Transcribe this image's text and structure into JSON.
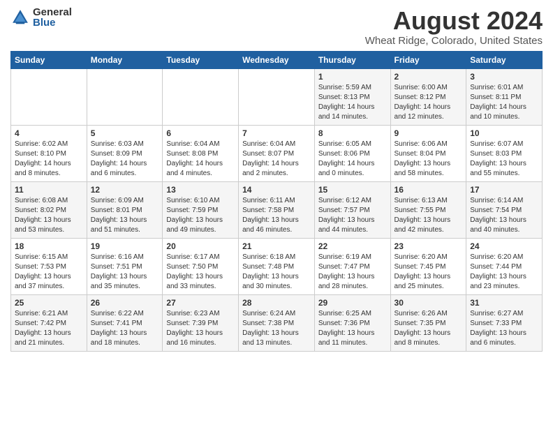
{
  "logo": {
    "general": "General",
    "blue": "Blue"
  },
  "title": "August 2024",
  "location": "Wheat Ridge, Colorado, United States",
  "weekdays": [
    "Sunday",
    "Monday",
    "Tuesday",
    "Wednesday",
    "Thursday",
    "Friday",
    "Saturday"
  ],
  "weeks": [
    [
      {
        "day": "",
        "sunrise": "",
        "sunset": "",
        "daylight": ""
      },
      {
        "day": "",
        "sunrise": "",
        "sunset": "",
        "daylight": ""
      },
      {
        "day": "",
        "sunrise": "",
        "sunset": "",
        "daylight": ""
      },
      {
        "day": "",
        "sunrise": "",
        "sunset": "",
        "daylight": ""
      },
      {
        "day": "1",
        "sunrise": "Sunrise: 5:59 AM",
        "sunset": "Sunset: 8:13 PM",
        "daylight": "Daylight: 14 hours and 14 minutes."
      },
      {
        "day": "2",
        "sunrise": "Sunrise: 6:00 AM",
        "sunset": "Sunset: 8:12 PM",
        "daylight": "Daylight: 14 hours and 12 minutes."
      },
      {
        "day": "3",
        "sunrise": "Sunrise: 6:01 AM",
        "sunset": "Sunset: 8:11 PM",
        "daylight": "Daylight: 14 hours and 10 minutes."
      }
    ],
    [
      {
        "day": "4",
        "sunrise": "Sunrise: 6:02 AM",
        "sunset": "Sunset: 8:10 PM",
        "daylight": "Daylight: 14 hours and 8 minutes."
      },
      {
        "day": "5",
        "sunrise": "Sunrise: 6:03 AM",
        "sunset": "Sunset: 8:09 PM",
        "daylight": "Daylight: 14 hours and 6 minutes."
      },
      {
        "day": "6",
        "sunrise": "Sunrise: 6:04 AM",
        "sunset": "Sunset: 8:08 PM",
        "daylight": "Daylight: 14 hours and 4 minutes."
      },
      {
        "day": "7",
        "sunrise": "Sunrise: 6:04 AM",
        "sunset": "Sunset: 8:07 PM",
        "daylight": "Daylight: 14 hours and 2 minutes."
      },
      {
        "day": "8",
        "sunrise": "Sunrise: 6:05 AM",
        "sunset": "Sunset: 8:06 PM",
        "daylight": "Daylight: 14 hours and 0 minutes."
      },
      {
        "day": "9",
        "sunrise": "Sunrise: 6:06 AM",
        "sunset": "Sunset: 8:04 PM",
        "daylight": "Daylight: 13 hours and 58 minutes."
      },
      {
        "day": "10",
        "sunrise": "Sunrise: 6:07 AM",
        "sunset": "Sunset: 8:03 PM",
        "daylight": "Daylight: 13 hours and 55 minutes."
      }
    ],
    [
      {
        "day": "11",
        "sunrise": "Sunrise: 6:08 AM",
        "sunset": "Sunset: 8:02 PM",
        "daylight": "Daylight: 13 hours and 53 minutes."
      },
      {
        "day": "12",
        "sunrise": "Sunrise: 6:09 AM",
        "sunset": "Sunset: 8:01 PM",
        "daylight": "Daylight: 13 hours and 51 minutes."
      },
      {
        "day": "13",
        "sunrise": "Sunrise: 6:10 AM",
        "sunset": "Sunset: 7:59 PM",
        "daylight": "Daylight: 13 hours and 49 minutes."
      },
      {
        "day": "14",
        "sunrise": "Sunrise: 6:11 AM",
        "sunset": "Sunset: 7:58 PM",
        "daylight": "Daylight: 13 hours and 46 minutes."
      },
      {
        "day": "15",
        "sunrise": "Sunrise: 6:12 AM",
        "sunset": "Sunset: 7:57 PM",
        "daylight": "Daylight: 13 hours and 44 minutes."
      },
      {
        "day": "16",
        "sunrise": "Sunrise: 6:13 AM",
        "sunset": "Sunset: 7:55 PM",
        "daylight": "Daylight: 13 hours and 42 minutes."
      },
      {
        "day": "17",
        "sunrise": "Sunrise: 6:14 AM",
        "sunset": "Sunset: 7:54 PM",
        "daylight": "Daylight: 13 hours and 40 minutes."
      }
    ],
    [
      {
        "day": "18",
        "sunrise": "Sunrise: 6:15 AM",
        "sunset": "Sunset: 7:53 PM",
        "daylight": "Daylight: 13 hours and 37 minutes."
      },
      {
        "day": "19",
        "sunrise": "Sunrise: 6:16 AM",
        "sunset": "Sunset: 7:51 PM",
        "daylight": "Daylight: 13 hours and 35 minutes."
      },
      {
        "day": "20",
        "sunrise": "Sunrise: 6:17 AM",
        "sunset": "Sunset: 7:50 PM",
        "daylight": "Daylight: 13 hours and 33 minutes."
      },
      {
        "day": "21",
        "sunrise": "Sunrise: 6:18 AM",
        "sunset": "Sunset: 7:48 PM",
        "daylight": "Daylight: 13 hours and 30 minutes."
      },
      {
        "day": "22",
        "sunrise": "Sunrise: 6:19 AM",
        "sunset": "Sunset: 7:47 PM",
        "daylight": "Daylight: 13 hours and 28 minutes."
      },
      {
        "day": "23",
        "sunrise": "Sunrise: 6:20 AM",
        "sunset": "Sunset: 7:45 PM",
        "daylight": "Daylight: 13 hours and 25 minutes."
      },
      {
        "day": "24",
        "sunrise": "Sunrise: 6:20 AM",
        "sunset": "Sunset: 7:44 PM",
        "daylight": "Daylight: 13 hours and 23 minutes."
      }
    ],
    [
      {
        "day": "25",
        "sunrise": "Sunrise: 6:21 AM",
        "sunset": "Sunset: 7:42 PM",
        "daylight": "Daylight: 13 hours and 21 minutes."
      },
      {
        "day": "26",
        "sunrise": "Sunrise: 6:22 AM",
        "sunset": "Sunset: 7:41 PM",
        "daylight": "Daylight: 13 hours and 18 minutes."
      },
      {
        "day": "27",
        "sunrise": "Sunrise: 6:23 AM",
        "sunset": "Sunset: 7:39 PM",
        "daylight": "Daylight: 13 hours and 16 minutes."
      },
      {
        "day": "28",
        "sunrise": "Sunrise: 6:24 AM",
        "sunset": "Sunset: 7:38 PM",
        "daylight": "Daylight: 13 hours and 13 minutes."
      },
      {
        "day": "29",
        "sunrise": "Sunrise: 6:25 AM",
        "sunset": "Sunset: 7:36 PM",
        "daylight": "Daylight: 13 hours and 11 minutes."
      },
      {
        "day": "30",
        "sunrise": "Sunrise: 6:26 AM",
        "sunset": "Sunset: 7:35 PM",
        "daylight": "Daylight: 13 hours and 8 minutes."
      },
      {
        "day": "31",
        "sunrise": "Sunrise: 6:27 AM",
        "sunset": "Sunset: 7:33 PM",
        "daylight": "Daylight: 13 hours and 6 minutes."
      }
    ]
  ]
}
